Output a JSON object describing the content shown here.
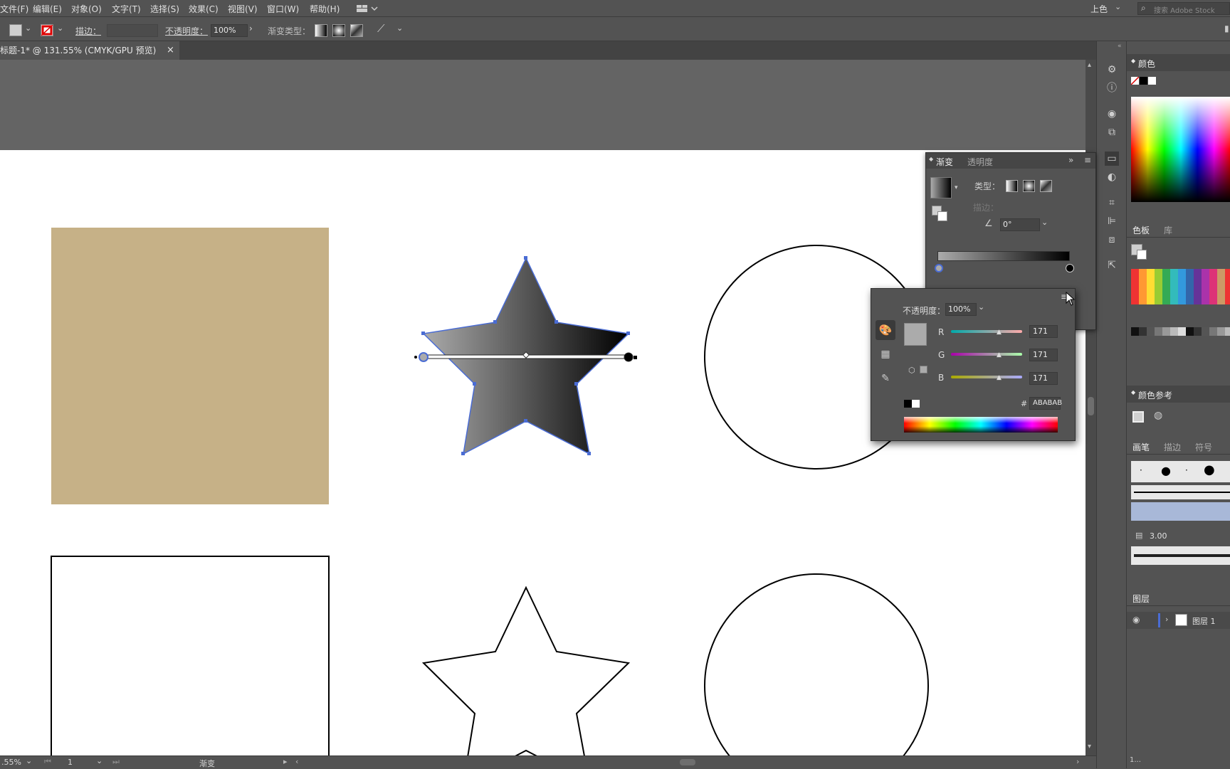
{
  "menubar": {
    "items": [
      "文件(F)",
      "编辑(E)",
      "对象(O)",
      "文字(T)",
      "选择(S)",
      "效果(C)",
      "视图(V)",
      "窗口(W)",
      "帮助(H)"
    ],
    "workspace": "上色",
    "search_placeholder": "搜索 Adobe Stock"
  },
  "controlbar": {
    "stroke_label": "描边：",
    "opacity_label": "不透明度：",
    "opacity_value": "100%",
    "gradient_type_label": "渐变类型："
  },
  "document": {
    "tab_title": "标题-1* @ 131.55% (CMYK/GPU 预览)",
    "close_glyph": "×"
  },
  "statusbar": {
    "zoom": ".55%",
    "page": "1",
    "tool": "渐变"
  },
  "gradient_panel": {
    "tabs": [
      "渐变",
      "透明度"
    ],
    "type_label": "类型：",
    "stroke_label": "描边：",
    "angle_value": "0°",
    "colors": {
      "start": "#ABABAB",
      "end": "#000000"
    }
  },
  "color_popup": {
    "opacity_label": "不透明度：",
    "opacity_value": "100%",
    "channels": [
      {
        "label": "R",
        "value": "171"
      },
      {
        "label": "G",
        "value": "171"
      },
      {
        "label": "B",
        "value": "171"
      }
    ],
    "hash": "#",
    "hex_value": "ABABAB",
    "swatch_color": "#ABABAB"
  },
  "right_dock": {
    "color_panel_title": "颜色",
    "swatches_tabs": [
      "色板",
      "库"
    ],
    "color_guide_title": "颜色参考",
    "brush_tabs": [
      "画笔",
      "描边",
      "符号"
    ],
    "brush_size": "3.00",
    "layers_title": "图层",
    "layer_name": "图层 1",
    "layers_count": "1..."
  },
  "colors": {
    "rect_fill": "#C6B187",
    "ui_bg": "#535353",
    "selection": "#4a6cd4"
  }
}
